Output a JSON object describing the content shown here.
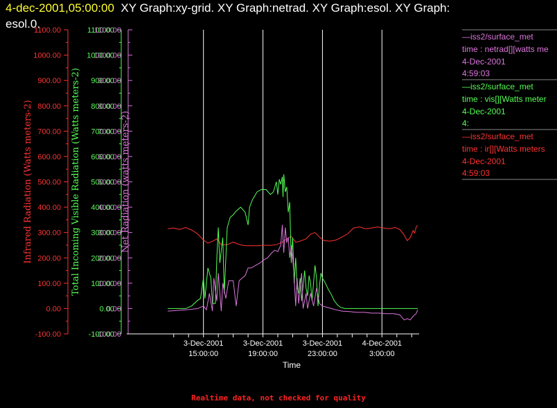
{
  "title": {
    "timestamp": "4-dec-2001,05:00:00",
    "line1_rest": "XY Graph:xy-grid.  XY Graph:netrad.  XY Graph:esol.  XY Graph:",
    "line2": "esol.0."
  },
  "footer": "Realtime data, not checked for quality",
  "colors": {
    "ir": "#ff3333",
    "vis": "#55ff55",
    "net": "#dd77dd",
    "grid": "#ffffff",
    "axis": "#ffffff"
  },
  "legend": [
    {
      "source": "—iss2/surface_met",
      "var": "time : netrad[][watts me",
      "date": "4-Dec-2001",
      "time": "4:59:03",
      "color": "#dd77dd"
    },
    {
      "source": "—iss2/surface_met",
      "var": "time : vis[][Watts meter",
      "date": "4-Dec-2001",
      "time": "4:",
      "color": "#55ff55"
    },
    {
      "source": "—iss2/surface_met",
      "var": "time : ir[][Watts meters",
      "date": "4-Dec-2001",
      "time": "4:59:03",
      "color": "#ff3333"
    }
  ],
  "chart_data": {
    "type": "line",
    "xlabel": "Time",
    "x_ticks": [
      {
        "line1": "3-Dec-2001",
        "line2": "15:00:00",
        "hours": 15
      },
      {
        "line1": "3-Dec-2001",
        "line2": "19:00:00",
        "hours": 19
      },
      {
        "line1": "3-Dec-2001",
        "line2": "23:00:00",
        "hours": 23
      },
      {
        "line1": "4-Dec-2001",
        "line2": "3:00:00",
        "hours": 27
      }
    ],
    "xlim_hours": [
      12.5,
      29.5
    ],
    "grid": "vertical",
    "y_axes": [
      {
        "name": "ir",
        "label": "Infrared Radiation (Watts meters-2)",
        "ylim": [
          -100,
          1100
        ],
        "ticks": [
          "-100.00",
          "0.00",
          "100.00",
          "200.00",
          "300.00",
          "400.00",
          "500.00",
          "600.00",
          "700.00",
          "800.00",
          "900.00",
          "1000.00",
          "1100.00"
        ]
      },
      {
        "name": "vis",
        "label": "Total Incoming Visible Radiation (Watts meters-2)",
        "ylim": [
          -100,
          1100
        ],
        "ticks": [
          "-100.00",
          "0.00",
          "100.00",
          "200.00",
          "300.00",
          "400.00",
          "500.00",
          "600.00",
          "700.00",
          "800.00",
          "900.00",
          "1000.00",
          "1100.00"
        ]
      },
      {
        "name": "net",
        "label": "Net Radiation (watts meters-2)",
        "ylim": [
          -100,
          1100
        ],
        "ticks": [
          "-100.00",
          "0.00",
          "100.00",
          "200.00",
          "300.00",
          "400.00",
          "500.00",
          "600.00",
          "700.00",
          "800.00",
          "900.00",
          "1000.00",
          "1100.00"
        ]
      }
    ],
    "series": [
      {
        "name": "ir",
        "points": [
          [
            12.6,
            315
          ],
          [
            13.0,
            318
          ],
          [
            13.4,
            312
          ],
          [
            13.8,
            320
          ],
          [
            14.2,
            310
          ],
          [
            14.6,
            295
          ],
          [
            15.0,
            270
          ],
          [
            15.3,
            258
          ],
          [
            15.6,
            265
          ],
          [
            15.9,
            275
          ],
          [
            16.2,
            252
          ],
          [
            16.6,
            252
          ],
          [
            17.0,
            262
          ],
          [
            17.3,
            255
          ],
          [
            17.6,
            250
          ],
          [
            17.9,
            248
          ],
          [
            18.3,
            248
          ],
          [
            18.7,
            248
          ],
          [
            19.1,
            250
          ],
          [
            19.5,
            249
          ],
          [
            19.9,
            252
          ],
          [
            20.3,
            262
          ],
          [
            20.6,
            275
          ],
          [
            20.9,
            285
          ],
          [
            21.2,
            262
          ],
          [
            21.5,
            266
          ],
          [
            21.9,
            275
          ],
          [
            22.2,
            293
          ],
          [
            22.5,
            300
          ],
          [
            22.8,
            282
          ],
          [
            23.1,
            268
          ],
          [
            23.5,
            266
          ],
          [
            23.9,
            270
          ],
          [
            24.3,
            282
          ],
          [
            24.7,
            295
          ],
          [
            25.1,
            318
          ],
          [
            25.5,
            322
          ],
          [
            25.9,
            315
          ],
          [
            26.3,
            318
          ],
          [
            26.7,
            322
          ],
          [
            27.1,
            318
          ],
          [
            27.5,
            315
          ],
          [
            27.9,
            320
          ],
          [
            28.2,
            312
          ],
          [
            28.5,
            290
          ],
          [
            28.7,
            268
          ],
          [
            28.9,
            280
          ],
          [
            29.1,
            308
          ],
          [
            29.2,
            298
          ],
          [
            29.3,
            322
          ],
          [
            29.4,
            328
          ]
        ]
      },
      {
        "name": "vis",
        "points": [
          [
            12.6,
            0
          ],
          [
            13.2,
            0
          ],
          [
            13.8,
            0
          ],
          [
            14.2,
            10
          ],
          [
            14.6,
            32
          ],
          [
            14.8,
            40
          ],
          [
            15.0,
            120
          ],
          [
            15.1,
            40
          ],
          [
            15.3,
            160
          ],
          [
            15.5,
            120
          ],
          [
            15.6,
            20
          ],
          [
            15.8,
            20
          ],
          [
            15.9,
            200
          ],
          [
            16.0,
            320
          ],
          [
            16.1,
            180
          ],
          [
            16.3,
            280
          ],
          [
            16.4,
            60
          ],
          [
            16.6,
            320
          ],
          [
            16.8,
            360
          ],
          [
            17.0,
            370
          ],
          [
            17.2,
            385
          ],
          [
            17.5,
            400
          ],
          [
            17.8,
            380
          ],
          [
            18.0,
            330
          ],
          [
            18.1,
            400
          ],
          [
            18.3,
            430
          ],
          [
            18.6,
            460
          ],
          [
            18.9,
            470
          ],
          [
            19.2,
            470
          ],
          [
            19.5,
            450
          ],
          [
            19.7,
            460
          ],
          [
            19.9,
            500
          ],
          [
            20.0,
            450
          ],
          [
            20.1,
            510
          ],
          [
            20.2,
            490
          ],
          [
            20.3,
            520
          ],
          [
            20.35,
            440
          ],
          [
            20.4,
            530
          ],
          [
            20.5,
            460
          ],
          [
            20.6,
            480
          ],
          [
            20.7,
            380
          ],
          [
            20.8,
            420
          ],
          [
            20.9,
            180
          ],
          [
            21.0,
            280
          ],
          [
            21.1,
            100
          ],
          [
            21.2,
            200
          ],
          [
            21.3,
            80
          ],
          [
            21.4,
            60
          ],
          [
            21.5,
            120
          ],
          [
            21.6,
            30
          ],
          [
            21.8,
            150
          ],
          [
            21.9,
            80
          ],
          [
            22.0,
            50
          ],
          [
            22.1,
            130
          ],
          [
            22.2,
            100
          ],
          [
            22.3,
            30
          ],
          [
            22.5,
            170
          ],
          [
            22.6,
            120
          ],
          [
            22.7,
            10
          ],
          [
            22.8,
            90
          ],
          [
            22.9,
            140
          ],
          [
            23.0,
            120
          ],
          [
            23.2,
            100
          ],
          [
            23.4,
            75
          ],
          [
            23.6,
            55
          ],
          [
            23.8,
            30
          ],
          [
            24.0,
            15
          ],
          [
            24.2,
            5
          ],
          [
            24.5,
            0
          ],
          [
            25.5,
            0
          ],
          [
            26.5,
            0
          ],
          [
            27.5,
            0
          ],
          [
            28.5,
            0
          ],
          [
            29.4,
            0
          ]
        ]
      },
      {
        "name": "net",
        "points": [
          [
            12.6,
            -10
          ],
          [
            13.2,
            -8
          ],
          [
            13.8,
            -5
          ],
          [
            14.2,
            -3
          ],
          [
            14.6,
            0
          ],
          [
            15.0,
            10
          ],
          [
            15.2,
            -5
          ],
          [
            15.4,
            60
          ],
          [
            15.6,
            -10
          ],
          [
            15.7,
            120
          ],
          [
            15.9,
            30
          ],
          [
            16.0,
            140
          ],
          [
            16.2,
            -10
          ],
          [
            16.3,
            100
          ],
          [
            16.5,
            40
          ],
          [
            16.7,
            110
          ],
          [
            17.0,
            110
          ],
          [
            17.2,
            10
          ],
          [
            17.4,
            110
          ],
          [
            17.6,
            120
          ],
          [
            17.8,
            130
          ],
          [
            18.0,
            160
          ],
          [
            18.2,
            160
          ],
          [
            18.5,
            170
          ],
          [
            18.8,
            180
          ],
          [
            19.0,
            190
          ],
          [
            19.3,
            200
          ],
          [
            19.6,
            220
          ],
          [
            19.8,
            230
          ],
          [
            20.0,
            225
          ],
          [
            20.2,
            250
          ],
          [
            20.3,
            330
          ],
          [
            20.4,
            220
          ],
          [
            20.5,
            320
          ],
          [
            20.6,
            260
          ],
          [
            20.7,
            280
          ],
          [
            20.8,
            200
          ],
          [
            20.9,
            250
          ],
          [
            21.0,
            200
          ],
          [
            21.1,
            120
          ],
          [
            21.2,
            10
          ],
          [
            21.3,
            120
          ],
          [
            21.4,
            20
          ],
          [
            21.6,
            140
          ],
          [
            21.7,
            0
          ],
          [
            21.9,
            60
          ],
          [
            22.0,
            0
          ],
          [
            22.2,
            60
          ],
          [
            22.4,
            10
          ],
          [
            22.6,
            80
          ],
          [
            22.8,
            20
          ],
          [
            23.0,
            10
          ],
          [
            23.3,
            5
          ],
          [
            23.6,
            0
          ],
          [
            23.9,
            -5
          ],
          [
            24.3,
            -10
          ],
          [
            24.8,
            -12
          ],
          [
            25.3,
            -15
          ],
          [
            25.8,
            -15
          ],
          [
            26.3,
            -18
          ],
          [
            26.8,
            -18
          ],
          [
            27.3,
            -20
          ],
          [
            27.8,
            -20
          ],
          [
            28.2,
            -25
          ],
          [
            28.5,
            -45
          ],
          [
            28.7,
            -40
          ],
          [
            28.9,
            -45
          ],
          [
            29.1,
            -30
          ],
          [
            29.3,
            -20
          ],
          [
            29.4,
            -5
          ]
        ]
      }
    ]
  }
}
